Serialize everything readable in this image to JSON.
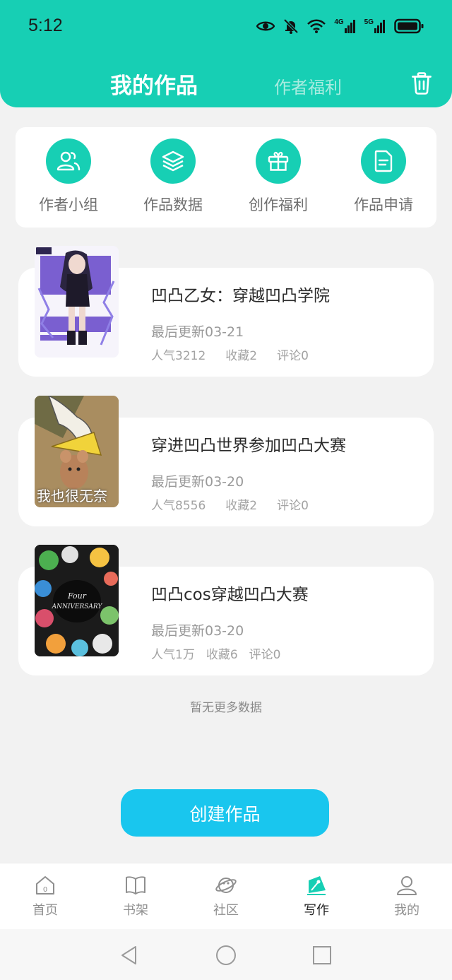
{
  "status_bar": {
    "time": "5:12",
    "network_4g": "4G",
    "network_5g": "5G"
  },
  "header": {
    "tab_my_works": "我的作品",
    "tab_author_benefits": "作者福利",
    "trash_icon": "trash-icon",
    "background_color": "#17cfb4"
  },
  "quick_menu": [
    {
      "label": "作者小组",
      "icon": "users-icon"
    },
    {
      "label": "作品数据",
      "icon": "layers-icon"
    },
    {
      "label": "创作福利",
      "icon": "gift-icon"
    },
    {
      "label": "作品申请",
      "icon": "document-icon"
    }
  ],
  "works": [
    {
      "title": "凹凸乙女：穿越凹凸学院",
      "updated": "最后更新03-21",
      "popularity": "人气3212",
      "favorites": "收藏2",
      "comments": "评论0"
    },
    {
      "title": "穿进凹凸世界参加凹凸大赛",
      "updated": "最后更新03-20",
      "popularity": "人气8556",
      "favorites": "收藏2",
      "comments": "评论0",
      "cover_caption": "我也很无奈"
    },
    {
      "title": "凹凸cos穿越凹凸大赛",
      "updated": "最后更新03-20",
      "popularity": "人气1万",
      "favorites": "收藏6",
      "comments": "评论0"
    }
  ],
  "no_more_text": "暂无更多数据",
  "create_button_label": "创建作品",
  "create_button_color": "#19c6ee",
  "bottom_nav": [
    {
      "label": "首页",
      "icon": "home-icon",
      "active": false
    },
    {
      "label": "书架",
      "icon": "book-icon",
      "active": false
    },
    {
      "label": "社区",
      "icon": "planet-icon",
      "active": false
    },
    {
      "label": "写作",
      "icon": "pen-icon",
      "active": true
    },
    {
      "label": "我的",
      "icon": "user-icon",
      "active": false
    }
  ],
  "system_nav": [
    "back-icon",
    "home-circle-icon",
    "recents-icon"
  ]
}
